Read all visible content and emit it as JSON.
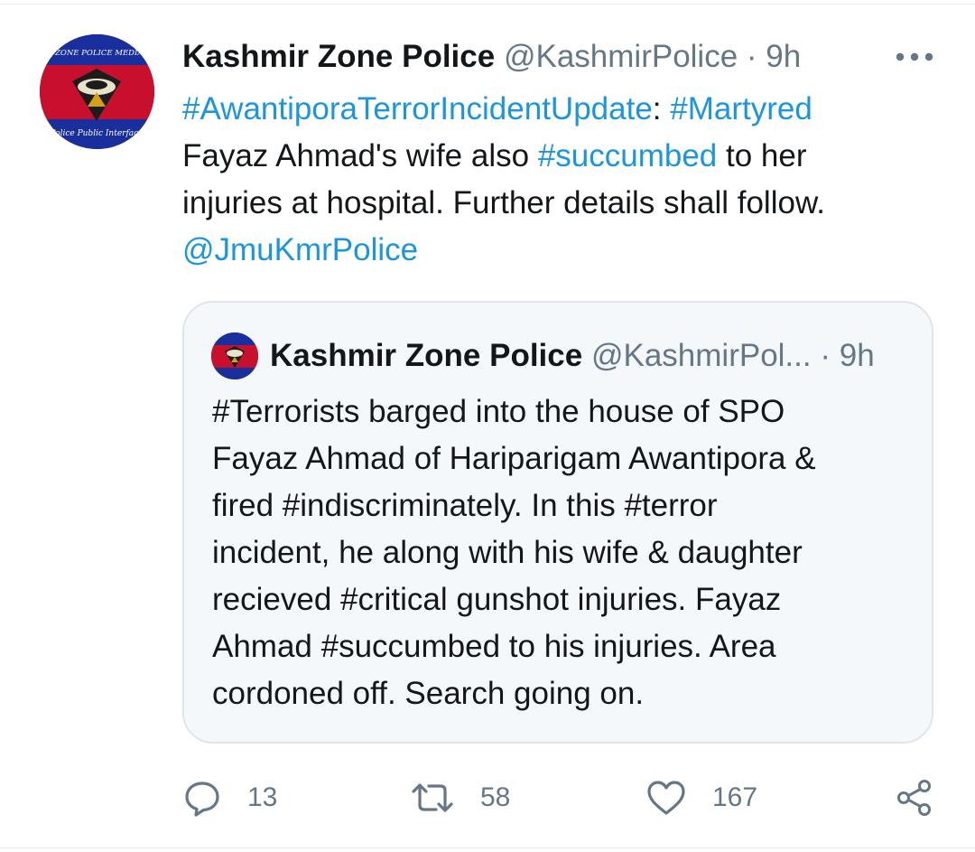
{
  "tweet": {
    "avatar_text_top": "KASHMIR ZONE POLICE MEDIA CENTER",
    "avatar_text_bottom": "Police Public Interface",
    "display_name": "Kashmir Zone Police",
    "handle": "@KashmirPolice",
    "separator": "·",
    "time": "9h",
    "more_icon": "more-horizontal-icon",
    "text": {
      "hashtag_1": "#AwantiporaTerrorIncidentUpdate",
      "colon": ":",
      "hashtag_2": "#Martyred",
      "line_2a": "Fayaz Ahmad's wife also",
      "hashtag_3": "#succumbed",
      "line_2b": "to her",
      "line_3": "injuries at hospital. Further details shall follow.",
      "mention": "@JmuKmrPolice"
    }
  },
  "quoted_tweet": {
    "display_name": "Kashmir Zone Police",
    "handle": "@KashmirPol...",
    "separator": "·",
    "time": "9h",
    "lines": [
      "#Terrorists barged into the house of SPO",
      "Fayaz Ahmad of Hariparigam Awantipora &",
      "fired #indiscriminately. In this #terror",
      "incident, he along with his wife & daughter",
      "recieved #critical gunshot injuries. Fayaz",
      "Ahmad #succumbed to his injuries. Area",
      "cordoned off. Search going on."
    ]
  },
  "actions": {
    "reply": {
      "icon": "reply-icon",
      "count": "13"
    },
    "retweet": {
      "icon": "retweet-icon",
      "count": "58"
    },
    "like": {
      "icon": "heart-icon",
      "count": "167"
    },
    "share": {
      "icon": "share-icon"
    }
  },
  "colors": {
    "link": "#1b95e0",
    "muted": "#657786",
    "text": "#14171a",
    "quote_bg": "#f5f8fa",
    "quote_border": "#dfe5ea"
  }
}
